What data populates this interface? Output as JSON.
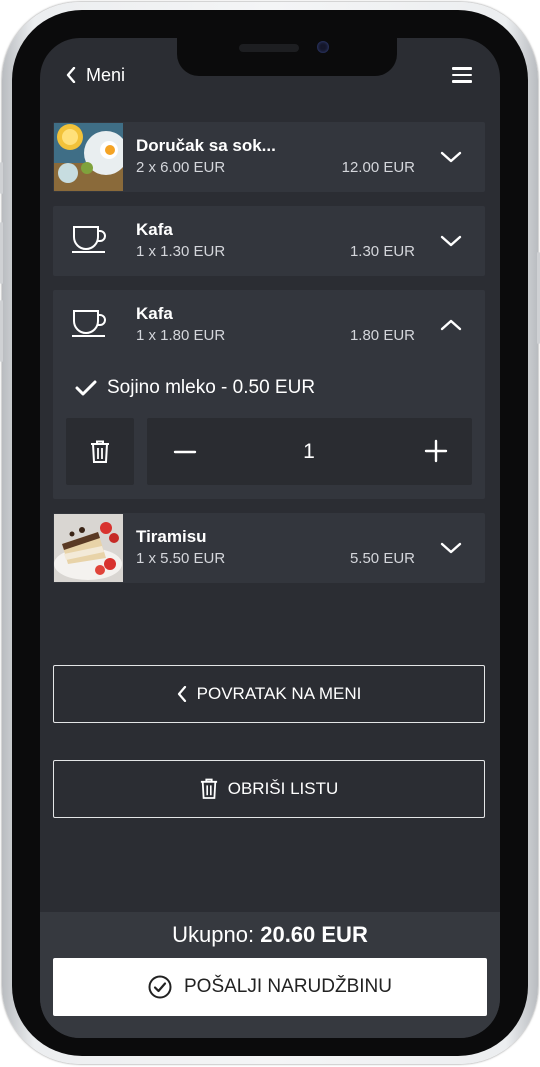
{
  "header": {
    "back_label": "Meni"
  },
  "cart": {
    "items": [
      {
        "title": "Doručak sa sok...",
        "qty": "2 x 6.00 EUR",
        "price": "12.00 EUR"
      },
      {
        "title": "Kafa",
        "qty": "1 x 1.30 EUR",
        "price": "1.30 EUR"
      },
      {
        "title": "Kafa",
        "qty": "1 x 1.80 EUR",
        "price": "1.80 EUR",
        "option": "Sojino mleko - 0.50 EUR",
        "quantity": "1"
      },
      {
        "title": "Tiramisu",
        "qty": "1 x 5.50 EUR",
        "price": "5.50 EUR"
      }
    ]
  },
  "actions": {
    "back_to_menu": "POVRATAK NA MENI",
    "clear_list": "OBRIŠI LISTU"
  },
  "footer": {
    "total_label": "Ukupno:",
    "total_value": "20.60 EUR",
    "send_label": "POŠALJI NARUDŽBINU"
  },
  "icons": [
    "chevron-left-icon",
    "hamburger-menu-icon",
    "food-thumbnail",
    "coffee-cup-icon",
    "chevron-down-icon",
    "chevron-up-icon",
    "check-icon",
    "trash-icon",
    "minus-icon",
    "plus-icon",
    "check-circle-icon"
  ],
  "colors": {
    "screen_bg": "#2b2d33",
    "card_bg": "#33363d",
    "footer_bg": "#36393f",
    "text": "#ffffff",
    "muted_text": "#d4d6db"
  }
}
